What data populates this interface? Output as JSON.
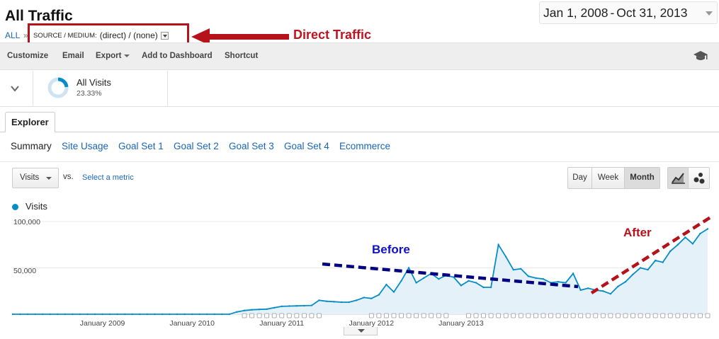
{
  "header": {
    "title": "All Traffic",
    "breadcrumb_all": "ALL",
    "breadcrumb_sep": "»",
    "segment_key": "SOURCE / MEDIUM:",
    "segment_value": "(direct) / (none)",
    "date_start": "Jan 1, 2008",
    "date_sep": "-",
    "date_end": "Oct 31, 2013"
  },
  "annotations": {
    "direct_traffic": "Direct Traffic",
    "before": "Before",
    "after": "After",
    "before_color": "#000080",
    "after_color": "#b5121b",
    "arrow_color": "#b5121b"
  },
  "toolbar": {
    "customize": "Customize",
    "email": "Email",
    "export": "Export",
    "add_to_dashboard": "Add to Dashboard",
    "shortcut": "Shortcut",
    "help_icon": "graduation-cap-icon"
  },
  "segment_card": {
    "name": "All Visits",
    "percent": "23.33%",
    "percent_value": 23.33
  },
  "tabs": {
    "explorer": "Explorer"
  },
  "subtabs": {
    "summary": "Summary",
    "site_usage": "Site Usage",
    "goal_set_1": "Goal Set 1",
    "goal_set_2": "Goal Set 2",
    "goal_set_3": "Goal Set 3",
    "goal_set_4": "Goal Set 4",
    "ecommerce": "Ecommerce"
  },
  "chart_controls": {
    "metric": "Visits",
    "vs": "vs.",
    "select_metric": "Select a metric",
    "day": "Day",
    "week": "Week",
    "month": "Month",
    "selected_granularity": "Month"
  },
  "chart_data": {
    "type": "area",
    "series": [
      {
        "name": "Visits",
        "color": "#058dc7",
        "values": [
          0,
          0,
          0,
          0,
          0,
          0,
          0,
          0,
          0,
          0,
          0,
          0,
          0,
          0,
          0,
          0,
          0,
          0,
          0,
          0,
          0,
          0,
          0,
          0,
          0,
          0,
          0,
          0,
          0,
          0,
          2500,
          4000,
          4800,
          5200,
          5500,
          7000,
          8500,
          8800,
          9000,
          9200,
          9500,
          15000,
          14000,
          13500,
          13000,
          13000,
          15000,
          18000,
          17000,
          21000,
          32000,
          24000,
          36000,
          50000,
          34000,
          39000,
          44000,
          38000,
          42000,
          40000,
          31000,
          36000,
          34000,
          29000,
          29000,
          75000,
          62000,
          48000,
          49000,
          41000,
          39000,
          38000,
          34000,
          35000,
          34000,
          44000,
          26000,
          28000,
          26000,
          25000,
          22000,
          30000,
          35000,
          43000,
          50000,
          48000,
          58000,
          56000,
          68000,
          75000,
          83000,
          76000,
          87000,
          92000
        ]
      }
    ],
    "x_start": "2008-01",
    "x_end": "2013-10",
    "x_tick_labels": [
      "January 2009",
      "January 2010",
      "January 2011",
      "January 2012",
      "January 2013"
    ],
    "y_tick_labels": [
      "100,000",
      "50,000"
    ],
    "ylim": [
      0,
      100000
    ],
    "legend": "top-left",
    "grid": true
  }
}
